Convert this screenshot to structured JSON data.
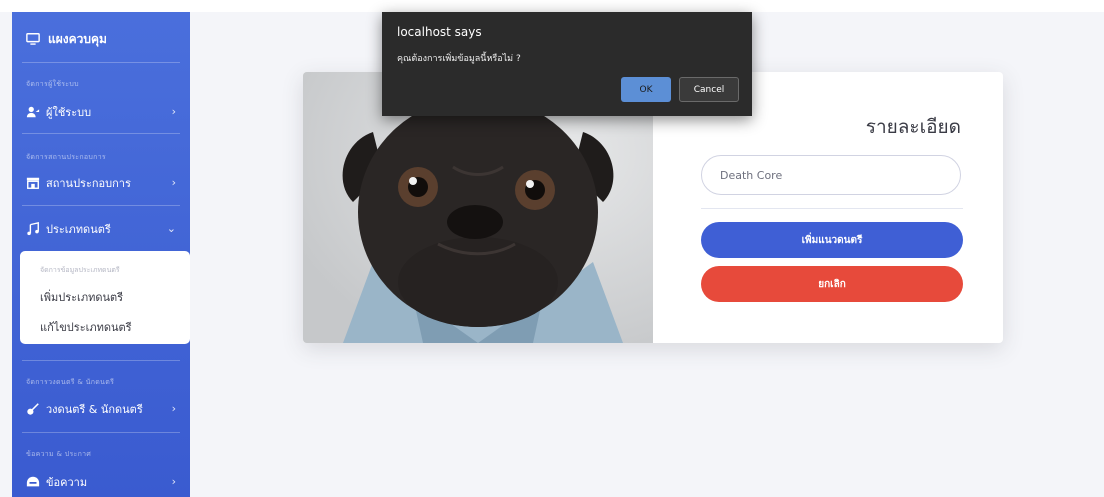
{
  "sidebar": {
    "brand": "แผงควบคุม",
    "sections": [
      {
        "head": "จัดการผู้ใช้ระบบ",
        "item": "ผู้ใช้ระบบ"
      },
      {
        "head": "จัดการสถานประกอบการ",
        "item": "สถานประกอบการ"
      },
      {
        "item": "ประเภทดนตรี"
      },
      {
        "head": "จัดการวงดนตรี & นักดนตรี",
        "item": "วงดนตรี & นักดนตรี"
      },
      {
        "head": "ข้อความ & ประกาศ",
        "item": "ข้อความ"
      }
    ],
    "submenu": {
      "head": "จัดการข้อมูลประเภทดนตรี",
      "links": [
        "เพิ่มประเภทดนตรี",
        "แก้ไขประเภทดนตรี"
      ]
    }
  },
  "card": {
    "title": "รายละเอียด",
    "input_value": "Death Core",
    "submit_label": "เพิ่มแนวดนตรี",
    "cancel_label": "ยกเลิก"
  },
  "dialog": {
    "title": "localhost says",
    "message": "คุณต้องการเพิ่มข้อมูลนี้หรือไม่ ?",
    "ok_label": "OK",
    "cancel_label": "Cancel"
  },
  "colors": {
    "sidebar": "#4a6fdc",
    "primary": "#3f5fd5",
    "danger": "#e74a3b",
    "dialog_bg": "#2b2b2b"
  },
  "icons": [
    "monitor-icon",
    "users-icon",
    "store-icon",
    "music-icon",
    "guitar-icon",
    "message-icon",
    "chevron-right-icon",
    "chevron-down-icon"
  ]
}
